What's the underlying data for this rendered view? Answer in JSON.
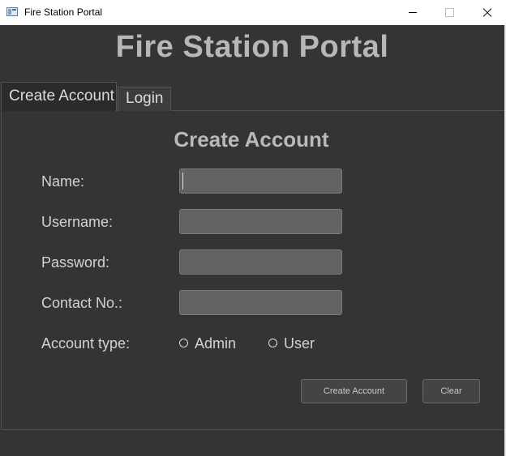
{
  "window": {
    "title": "Fire Station Portal"
  },
  "app": {
    "header_title": "Fire Station Portal"
  },
  "tabs": [
    {
      "label": "Create Account",
      "selected": true
    },
    {
      "label": "Login",
      "selected": false
    }
  ],
  "form": {
    "title": "Create Account",
    "fields": {
      "name": {
        "label": "Name:",
        "value": ""
      },
      "username": {
        "label": "Username:",
        "value": ""
      },
      "password": {
        "label": "Password:",
        "value": ""
      },
      "contact": {
        "label": "Contact No.:",
        "value": ""
      }
    },
    "account_type": {
      "label": "Account type:",
      "options": [
        {
          "label": "Admin",
          "selected": false
        },
        {
          "label": "User",
          "selected": false
        }
      ]
    },
    "buttons": {
      "create": "Create Account",
      "clear": "Clear"
    }
  },
  "colors": {
    "background": "#343434",
    "text": "#d3d3d3",
    "field": "#626262"
  }
}
